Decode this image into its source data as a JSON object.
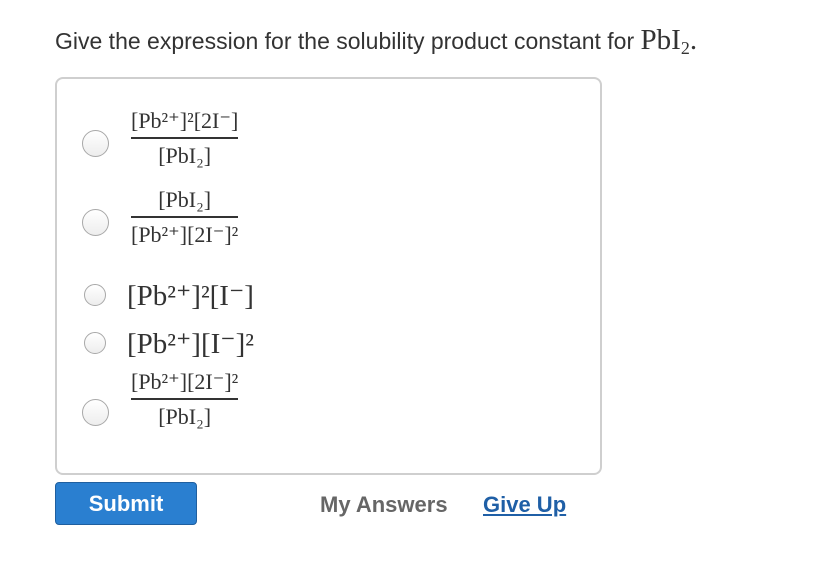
{
  "question": {
    "text": "Give the expression for the solubility product constant for ",
    "formula_main": "PbI",
    "formula_sub": "2",
    "formula_end": "."
  },
  "options": [
    {
      "num": "[Pb²⁺]²[2I⁻]",
      "den": "[PbI₂]"
    },
    {
      "num": "[PbI₂]",
      "den": "[Pb²⁺][2I⁻]²"
    },
    {
      "expr": "[Pb²⁺]²[I⁻]"
    },
    {
      "expr": "[Pb²⁺][I⁻]²"
    },
    {
      "num": "[Pb²⁺][2I⁻]²",
      "den": "[PbI₂]"
    }
  ],
  "actions": {
    "submit": "Submit",
    "my_answers": "My Answers",
    "give_up": "Give Up"
  },
  "colors": {
    "submit_bg": "#2a7fd0",
    "link": "#1f5fa6",
    "border": "#cfcfcf"
  }
}
